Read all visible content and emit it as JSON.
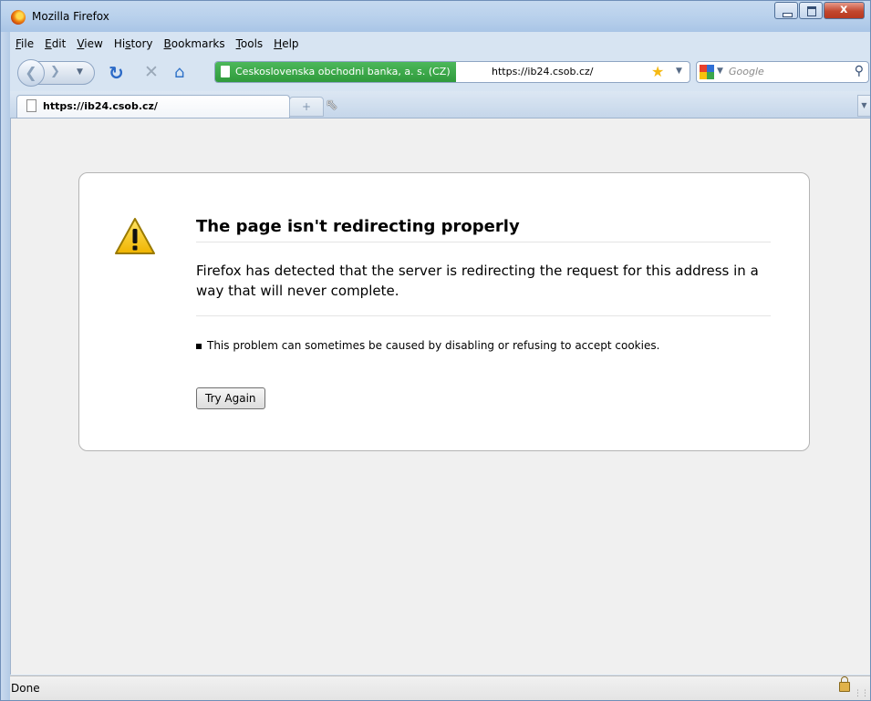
{
  "window": {
    "title": "Mozilla Firefox"
  },
  "menu": {
    "items": [
      {
        "label": "File",
        "u": "F",
        "rest": "ile"
      },
      {
        "label": "Edit",
        "u": "E",
        "rest": "dit"
      },
      {
        "label": "View",
        "u": "V",
        "rest": "iew"
      },
      {
        "label": "History",
        "pre": "Hi",
        "u": "s",
        "rest": "tory"
      },
      {
        "label": "Bookmarks",
        "u": "B",
        "rest": "ookmarks"
      },
      {
        "label": "Tools",
        "u": "T",
        "rest": "ools"
      },
      {
        "label": "Help",
        "u": "H",
        "rest": "elp"
      }
    ]
  },
  "nav": {
    "identity_label": "Ceskoslovenska obchodni banka, a. s. (CZ)",
    "url": "https://ib24.csob.cz/",
    "search_placeholder": "Google"
  },
  "tabs": [
    {
      "label": "https://ib24.csob.cz/"
    }
  ],
  "error": {
    "title": "The page isn't redirecting properly",
    "description": "Firefox has detected that the server is redirecting the request for this address in a way that will never complete.",
    "hint": "This problem can sometimes be caused by disabling or refusing to accept cookies.",
    "button": "Try Again"
  },
  "status": {
    "text": "Done"
  },
  "icons": {
    "firefox": "firefox-logo-icon",
    "back": "back-arrow-icon",
    "forward": "forward-arrow-icon",
    "reload": "reload-icon",
    "stop": "stop-icon",
    "home": "home-icon",
    "bookmark": "star-icon",
    "search": "magnifier-icon",
    "warning": "warning-triangle-icon",
    "lock": "padlock-icon"
  },
  "colors": {
    "identity_green": "#2f9a3c",
    "content_bg": "#f0f0f0",
    "titlebar": "#b9d1ec"
  }
}
